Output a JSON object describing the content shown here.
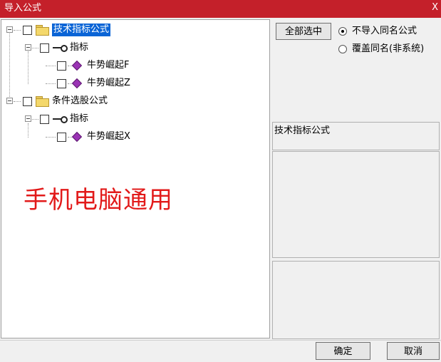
{
  "window": {
    "title": "导入公式",
    "close_glyph": "X"
  },
  "tree": {
    "groups": [
      {
        "label": "技术指标公式",
        "selected": true,
        "child": {
          "label": "指标",
          "items": [
            "牛势崛起F",
            "牛势崛起Z"
          ]
        }
      },
      {
        "label": "条件选股公式",
        "selected": false,
        "child": {
          "label": "指标",
          "items": [
            "牛势崛起X"
          ]
        }
      }
    ]
  },
  "watermark": "手机电脑通用",
  "options": {
    "select_all_label": "全部选中",
    "radio_skip_label": "不导入同名公式",
    "radio_overwrite_label": "覆盖同名(非系统)",
    "selected": "skip"
  },
  "description": {
    "title": "技术指标公式"
  },
  "footer": {
    "ok_label": "确定",
    "cancel_label": "取消"
  },
  "icons": {
    "folder": "folder-icon",
    "indicator": "key-icon",
    "formula": "purple-diamond-icon",
    "expander": "minus-expander-icon"
  },
  "colors": {
    "titlebar": "#c4202a",
    "selection": "#0a64d6",
    "watermark": "#e21a1a",
    "formula_icon": "#9a33b4"
  }
}
